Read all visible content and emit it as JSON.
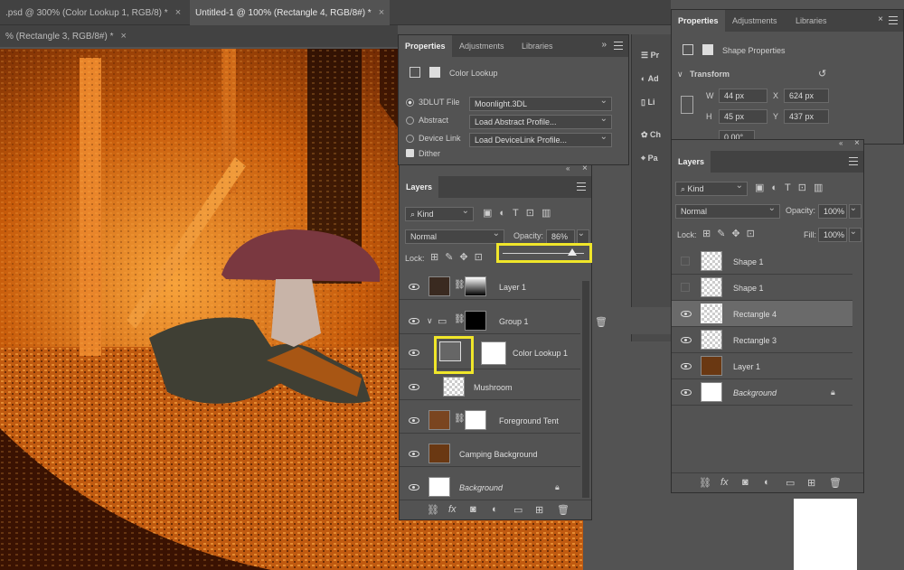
{
  "tabs": {
    "tab1": "Untitled-1 @ 100% (Rectangle 4, RGB/8#) *",
    "tab0": ".psd @ 300% (Color Lookup 1, RGB/8) *",
    "tab2": "% (Rectangle 3, RGB/8#) *",
    "close": "×"
  },
  "props_left": {
    "tabs": [
      "Properties",
      "Adjustments",
      "Libraries"
    ],
    "header": "Color Lookup",
    "options": [
      {
        "label": "3DLUT File",
        "value": "Moonlight.3DL",
        "selected": true
      },
      {
        "label": "Abstract",
        "value": "Load Abstract Profile...",
        "selected": false
      },
      {
        "label": "Device Link",
        "value": "Load DeviceLink Profile...",
        "selected": false
      }
    ],
    "dither": "Dither"
  },
  "layers_left": {
    "title": "Layers",
    "kind": "Kind",
    "blend": "Normal",
    "opacity_label": "Opacity:",
    "opacity_value": "86%",
    "opacity_fraction": 0.86,
    "lock_label": "Lock:",
    "layers": [
      {
        "name": "Layer 1"
      },
      {
        "name": "Group 1"
      },
      {
        "name": "Color Lookup 1"
      },
      {
        "name": "Mushroom"
      },
      {
        "name": "Foreground Tent"
      },
      {
        "name": "Camping Background"
      },
      {
        "name": "Background"
      }
    ]
  },
  "side_strip": {
    "items": [
      "Pr",
      "Ad",
      "Li",
      "Ch",
      "Pa"
    ]
  },
  "props_right": {
    "tabs": [
      "Properties",
      "Adjustments",
      "Libraries"
    ],
    "header": "Shape Properties",
    "transform": "Transform",
    "w_label": "W",
    "w_value": "44 px",
    "h_label": "H",
    "h_value": "45 px",
    "x_label": "X",
    "x_value": "624 px",
    "y_label": "Y",
    "y_value": "437 px",
    "angle_value": "0.00°"
  },
  "layers_right": {
    "title": "Layers",
    "kind": "Kind",
    "blend": "Normal",
    "opacity_label": "Opacity:",
    "opacity_value": "100%",
    "lock_label": "Lock:",
    "fill_label": "Fill:",
    "fill_value": "100%",
    "layers": [
      {
        "name": "Shape 1",
        "visible": false
      },
      {
        "name": "Shape 1",
        "visible": false
      },
      {
        "name": "Rectangle 4",
        "visible": true,
        "selected": true
      },
      {
        "name": "Rectangle 3",
        "visible": true
      },
      {
        "name": "Layer 1",
        "visible": true
      },
      {
        "name": "Background",
        "visible": true
      }
    ]
  },
  "colors": {
    "highlight": "#f0e62a",
    "panel": "#535353",
    "tabbar": "#424242"
  }
}
